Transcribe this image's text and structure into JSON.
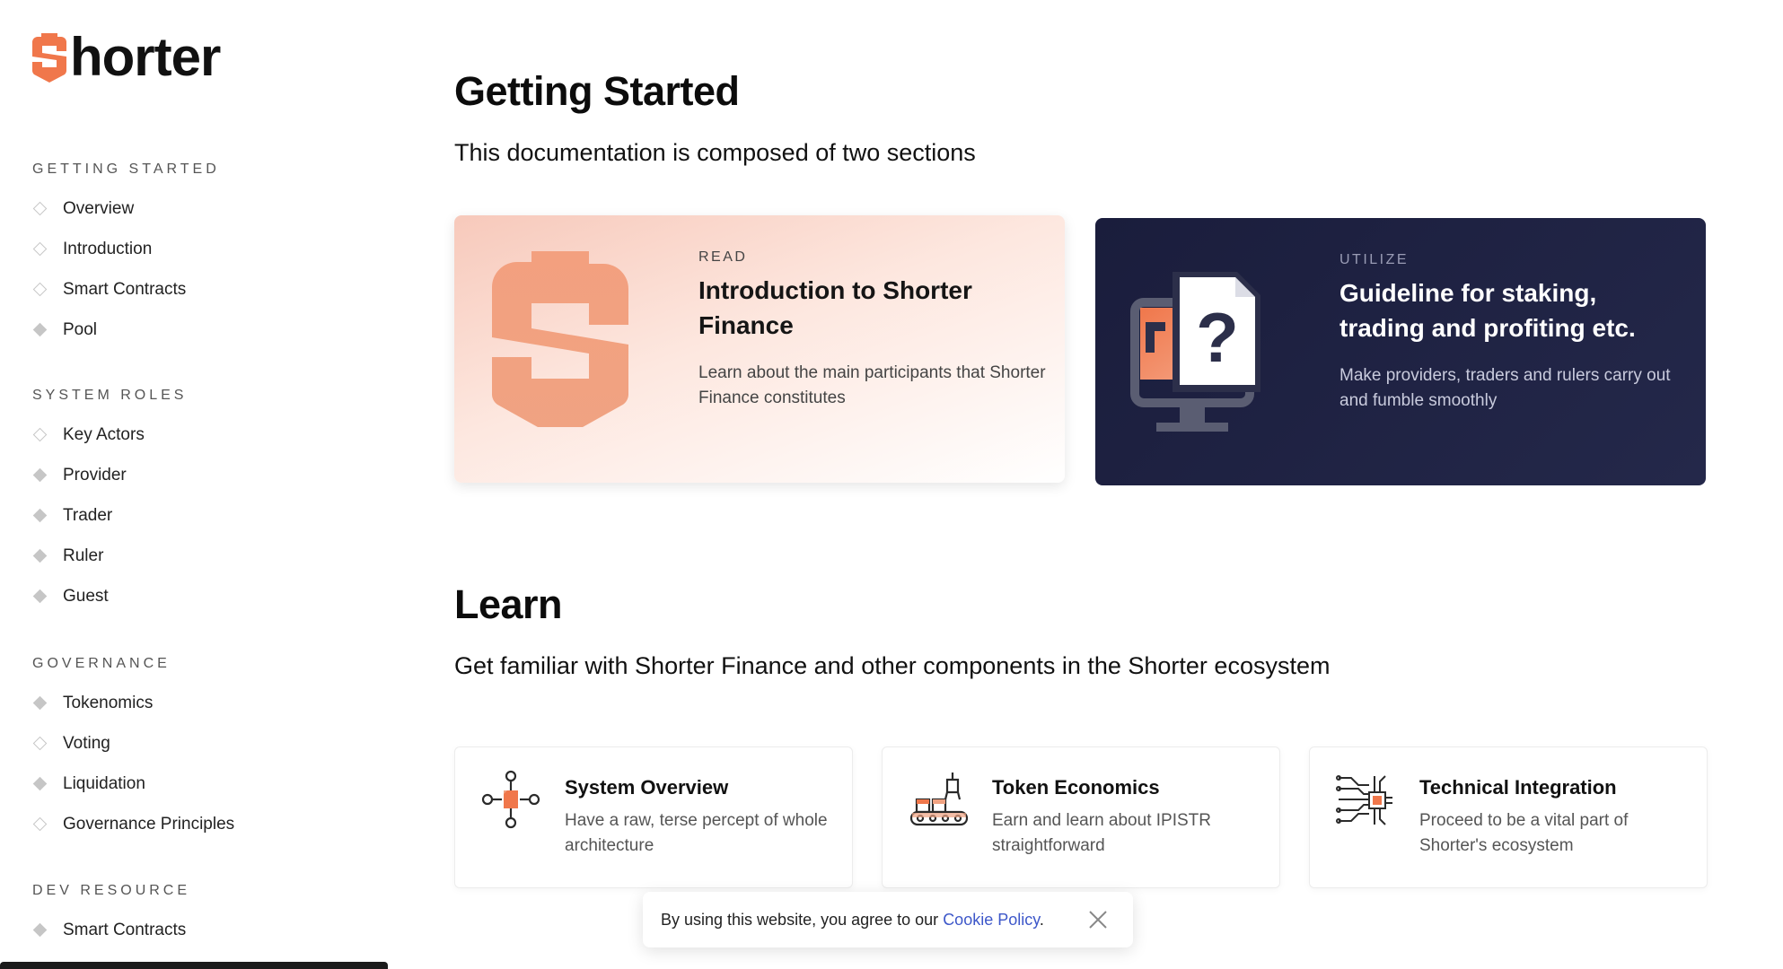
{
  "brand": {
    "name": "Shorter",
    "accent": "#f0774b"
  },
  "sidebar": {
    "sections": [
      {
        "heading": "GETTING STARTED",
        "items": [
          {
            "label": "Overview",
            "marker": "hollow"
          },
          {
            "label": "Introduction",
            "marker": "hollow"
          },
          {
            "label": "Smart Contracts",
            "marker": "hollow"
          },
          {
            "label": "Pool",
            "marker": "filled"
          }
        ]
      },
      {
        "heading": "SYSTEM ROLES",
        "items": [
          {
            "label": "Key Actors",
            "marker": "hollow"
          },
          {
            "label": "Provider",
            "marker": "filled"
          },
          {
            "label": "Trader",
            "marker": "filled"
          },
          {
            "label": "Ruler",
            "marker": "filled"
          },
          {
            "label": "Guest",
            "marker": "filled"
          }
        ]
      },
      {
        "heading": "GOVERNANCE",
        "items": [
          {
            "label": "Tokenomics",
            "marker": "filled"
          },
          {
            "label": "Voting",
            "marker": "hollow"
          },
          {
            "label": "Liquidation",
            "marker": "filled"
          },
          {
            "label": "Governance Principles",
            "marker": "hollow"
          }
        ]
      },
      {
        "heading": "DEV RESOURCE",
        "items": [
          {
            "label": "Smart Contracts",
            "marker": "filled"
          }
        ]
      }
    ]
  },
  "getting_started": {
    "title": "Getting Started",
    "subtitle": "This documentation is composed of two sections",
    "cards": [
      {
        "eyebrow": "READ",
        "title": "Introduction to Shorter Finance",
        "description": "Learn about the main participants that Shorter Finance constitutes",
        "icon": "shorter-logo-icon"
      },
      {
        "eyebrow": "UTILIZE",
        "title": "Guideline for staking, trading and profiting etc.",
        "description": "Make providers, traders and rulers carry out and fumble smoothly",
        "icon": "computer-question-icon"
      }
    ]
  },
  "learn": {
    "title": "Learn",
    "subtitle": "Get familiar with Shorter Finance and other components in the Shorter ecosystem",
    "cards": [
      {
        "title": "System Overview",
        "description": "Have a raw, terse percept of whole architecture",
        "icon": "network-node-icon"
      },
      {
        "title": "Token Economics",
        "description": "Earn and learn about IPISTR straightforward",
        "icon": "conveyor-belt-icon"
      },
      {
        "title": "Technical Integration",
        "description": "Proceed to be a vital part of Shorter's ecosystem",
        "icon": "circuit-chip-icon"
      }
    ]
  },
  "cookie": {
    "text": "By using this website, you agree to our ",
    "link": "Cookie Policy",
    "suffix": "."
  }
}
